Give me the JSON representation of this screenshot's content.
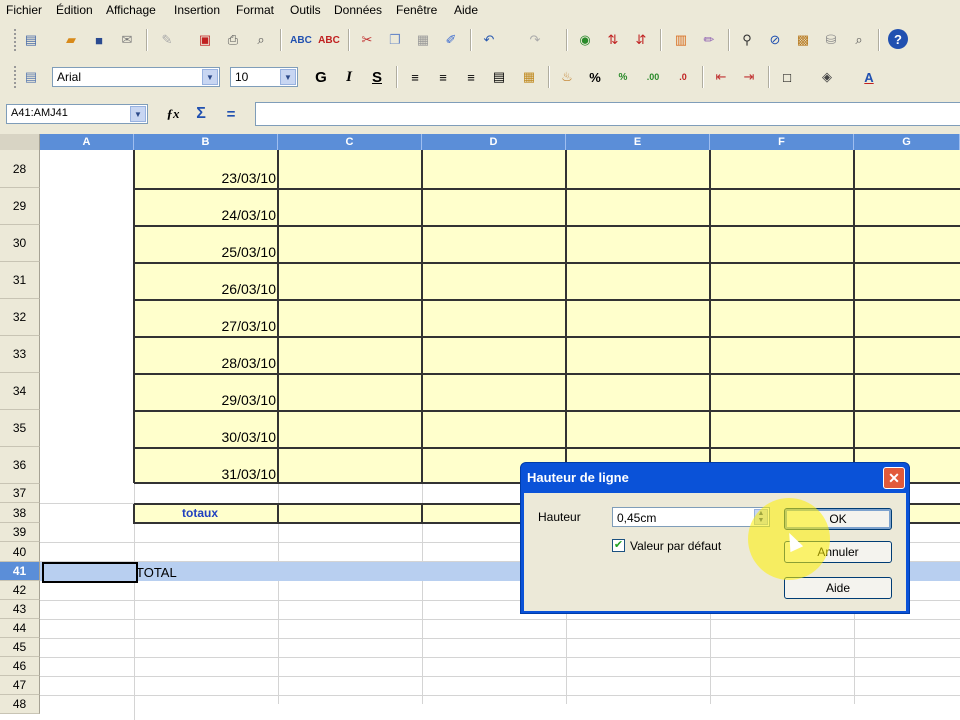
{
  "menu": [
    "Fichier",
    "Édition",
    "Affichage",
    "Insertion",
    "Format",
    "Outils",
    "Données",
    "Fenêtre",
    "Aide"
  ],
  "toolbar": {
    "font_name": "Arial",
    "font_size": "10",
    "bold_label": "G",
    "italic_label": "I",
    "underline_label": "S"
  },
  "formula": {
    "name_box": "A41:AMJ41",
    "fx_label": "ƒx",
    "sum_label": "Σ",
    "equals_label": "="
  },
  "columns": [
    "A",
    "B",
    "C",
    "D",
    "E",
    "F",
    "G"
  ],
  "rows": [
    {
      "num": "28",
      "date": "23/03/10"
    },
    {
      "num": "29",
      "date": "24/03/10"
    },
    {
      "num": "30",
      "date": "25/03/10"
    },
    {
      "num": "31",
      "date": "26/03/10"
    },
    {
      "num": "32",
      "date": "27/03/10"
    },
    {
      "num": "33",
      "date": "28/03/10"
    },
    {
      "num": "34",
      "date": "29/03/10"
    },
    {
      "num": "35",
      "date": "30/03/10"
    },
    {
      "num": "36",
      "date": "31/03/10"
    }
  ],
  "small_rows": [
    "37",
    "38",
    "39",
    "40",
    "41",
    "42",
    "43",
    "44",
    "45",
    "46",
    "47",
    "48"
  ],
  "totaux_label": "totaux",
  "total_label": "TOTAL",
  "dialog": {
    "title": "Hauteur de ligne",
    "height_label": "Hauteur",
    "height_value": "0,45cm",
    "default_label": "Valeur par défaut",
    "ok_label": "OK",
    "cancel_label": "Annuler",
    "help_label": "Aide"
  },
  "colors": {
    "header_blue": "#5b8ed8",
    "cell_yellow": "#ffffcc",
    "dialog_blue": "#0a52d8"
  }
}
